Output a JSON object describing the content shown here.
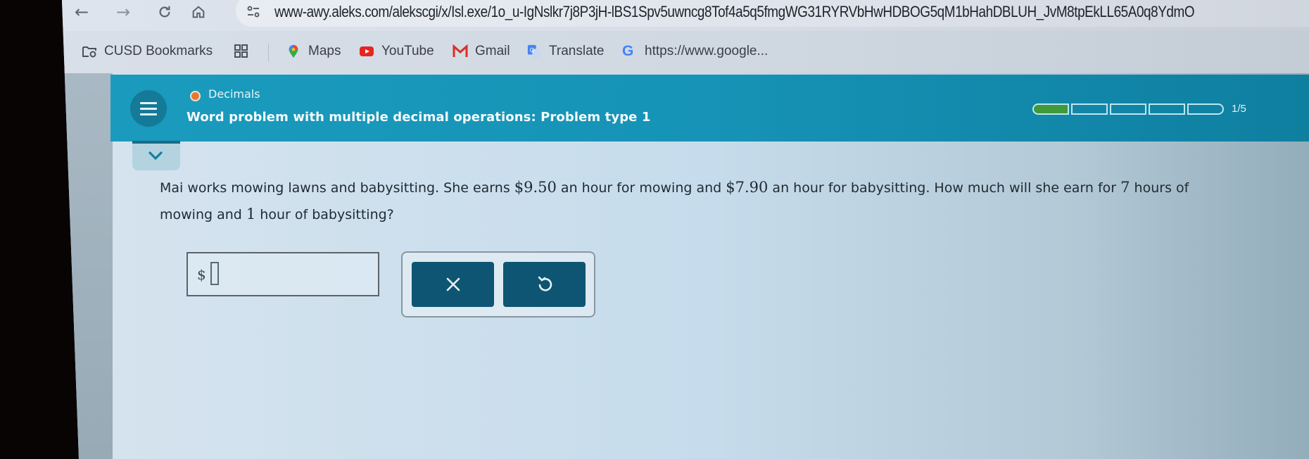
{
  "browser": {
    "nav": {
      "back_icon": "arrow-left-icon",
      "forward_icon": "arrow-right-icon",
      "reload_icon": "reload-icon",
      "home_icon": "home-icon",
      "site_info_icon": "tune-icon"
    },
    "url": "www-awy.aleks.com/alekscgi/x/Isl.exe/1o_u-IgNslkr7j8P3jH-lBS1Spv5uwncg8Tof4a5q5fmgWG31RYRVbHwHDBOG5qM1bHahDBLUH_JvM8tpEkLL65A0q8YdmO",
    "bookmarks": [
      {
        "label": "CUSD Bookmarks",
        "icon": "folder-managed-icon"
      },
      {
        "label": "",
        "icon": "apps-grid-icon"
      },
      {
        "label": "Maps",
        "icon": "maps-pin-icon"
      },
      {
        "label": "YouTube",
        "icon": "youtube-icon"
      },
      {
        "label": "Gmail",
        "icon": "gmail-icon"
      },
      {
        "label": "Translate",
        "icon": "translate-icon"
      },
      {
        "label": "https://www.google...",
        "icon": "google-icon"
      }
    ]
  },
  "header": {
    "menu_icon": "hamburger-menu-icon",
    "topic": "Decimals",
    "topic_status_color": "#e27b30",
    "problem_title": "Word problem with multiple decimal operations: Problem type 1",
    "progress": {
      "completed": 1,
      "total": 5,
      "label": "1/5",
      "fill_color": "#3e9a3a"
    },
    "accent_color": "#1693b6"
  },
  "collapse_icon": "chevron-down-icon",
  "question": {
    "line1_a": "Mai works mowing lawns and babysitting. She earns ",
    "rate_mowing": "$9.50",
    "line1_b": " an hour for mowing and ",
    "rate_babysitting": "$7.90",
    "line1_c": " an hour for babysitting. How much will she earn for ",
    "hours_mowing": "7",
    "line1_d": " hours of",
    "line2_a": "mowing and ",
    "hours_babysitting": "1",
    "line2_b": " hour of babysitting?"
  },
  "answer": {
    "prefix": "$",
    "value": ""
  },
  "buttons": {
    "clear_icon": "close-x-icon",
    "undo_icon": "undo-icon",
    "color": "#0e5573"
  }
}
